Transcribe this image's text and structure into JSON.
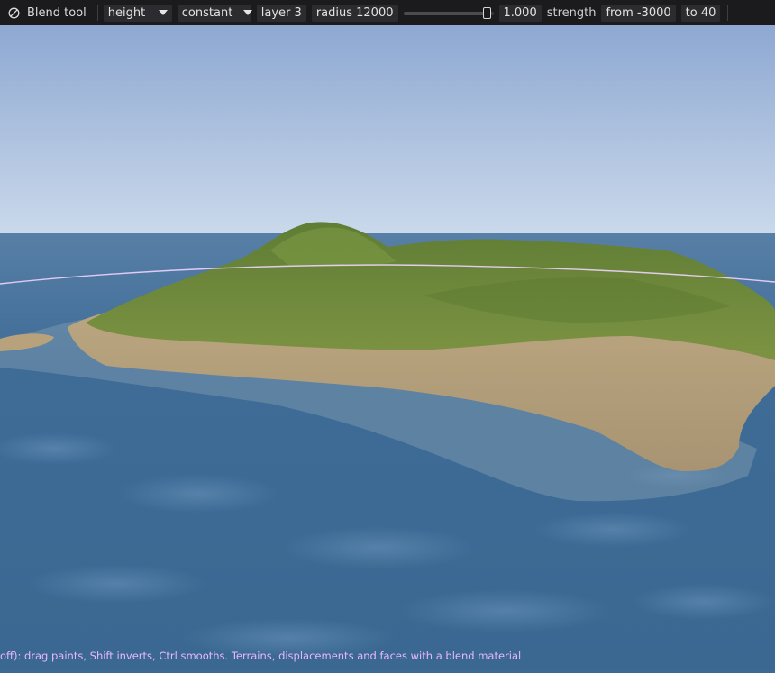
{
  "toolbar": {
    "tool_icon": "blend-icon",
    "tool_name": "Blend tool",
    "attribute": "height",
    "mode": "constant",
    "layer": "layer 3",
    "radius": "radius 12000",
    "strength_fraction": 0.97,
    "strength_value": "1.000",
    "strength_label": "strength",
    "from": "from -3000",
    "to": "to 40"
  },
  "status_text": "off): drag paints, Shift inverts, Ctrl smooths. Terrains, displacements and faces with a blend material",
  "colors": {
    "toolbar_bg": "#1b1b1d",
    "sky_top": "#8fa9d3",
    "sky_horizon": "#c7d6ea",
    "ocean": "#3f6e98",
    "grass": "#6b8a3a",
    "sand": "#b7a27c",
    "brush_ring": "#e8c6f5",
    "status_text": "#e9b7ff"
  }
}
